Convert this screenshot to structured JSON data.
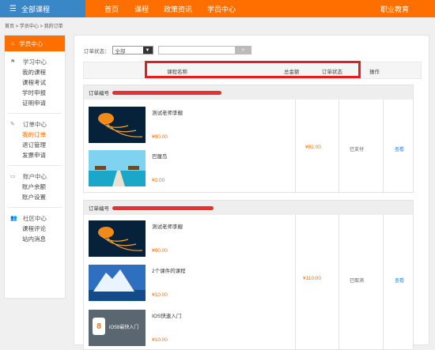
{
  "topbar": {
    "all_courses": "全部课程",
    "nav": [
      "首页",
      "课程",
      "政策资讯",
      "学员中心"
    ],
    "right": "职业教育"
  },
  "breadcrumb": "首页 > 学员中心 > 我的订单",
  "sidebar": {
    "header": "学员中心",
    "sections": [
      {
        "title": "学习中心",
        "items": [
          "我的课程",
          "课程考试",
          "学时申报",
          "证明申请"
        ]
      },
      {
        "title": "订单中心",
        "items": [
          "我的订单",
          "退订管理",
          "发票申请"
        ]
      },
      {
        "title": "账户中心",
        "items": [
          "账户余额",
          "账户设置"
        ]
      },
      {
        "title": "社区中心",
        "items": [
          "课程评论",
          "站内消息"
        ]
      }
    ],
    "active_item": "我的订单"
  },
  "filter": {
    "label": "订单状态：",
    "selected": "全部",
    "search_btn": "🔍"
  },
  "table_head": {
    "course_name": "课程名称",
    "total": "总金额",
    "status": "订单状态",
    "action": "操作"
  },
  "orders": [
    {
      "label": "订单编号",
      "items": [
        {
          "name": "测试老师李靓",
          "price": "¥90.00"
        },
        {
          "name": "巴厘岛",
          "price": "¥2.00"
        }
      ],
      "total": "¥92.00",
      "status": "已支付",
      "action": "查看"
    },
    {
      "label": "订单编号",
      "items": [
        {
          "name": "测试老师李靓",
          "price": "¥90.00"
        },
        {
          "name": "2个课件的课程",
          "price": "¥10.00"
        },
        {
          "name": "IOS快速入门",
          "price": "¥10.00"
        }
      ],
      "total": "¥110.00",
      "status": "已取消",
      "action": "查看",
      "ios_thumb_text": "iOS8最快入门"
    }
  ],
  "colors": {
    "accent": "#ff6f00",
    "header_blue": "#3a87c8",
    "highlight_red": "#e02020",
    "link_blue": "#1e88e5"
  }
}
